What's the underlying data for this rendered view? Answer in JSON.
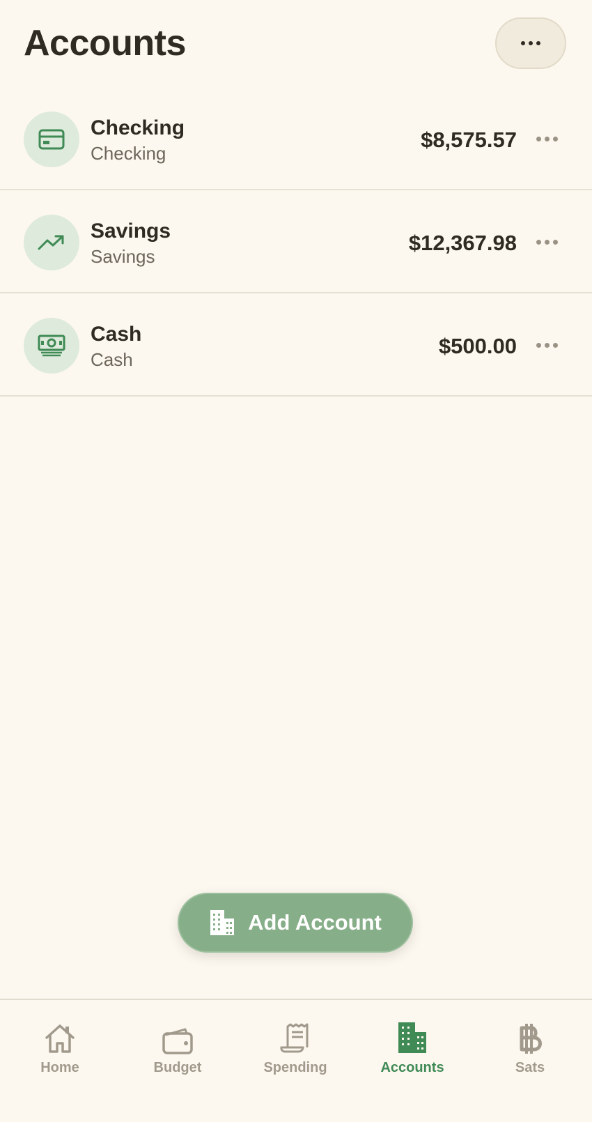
{
  "header": {
    "title": "Accounts",
    "menu_icon": "more-horizontal-icon"
  },
  "accounts": [
    {
      "name": "Checking",
      "type": "Checking",
      "balance": "$8,575.57",
      "icon": "credit-card-icon"
    },
    {
      "name": "Savings",
      "type": "Savings",
      "balance": "$12,367.98",
      "icon": "trending-up-icon"
    },
    {
      "name": "Cash",
      "type": "Cash",
      "balance": "$500.00",
      "icon": "cash-icon"
    }
  ],
  "add_button": {
    "label": "Add Account",
    "icon": "building-icon"
  },
  "tabs": [
    {
      "label": "Home",
      "icon": "home-icon",
      "active": false
    },
    {
      "label": "Budget",
      "icon": "wallet-icon",
      "active": false
    },
    {
      "label": "Spending",
      "icon": "receipt-icon",
      "active": false
    },
    {
      "label": "Accounts",
      "icon": "building-icon",
      "active": true
    },
    {
      "label": "Sats",
      "icon": "bitcoin-icon",
      "active": false
    }
  ],
  "colors": {
    "background": "#fcf8f0",
    "accent": "#3f8a55",
    "button": "#86ae88",
    "avatar_bg": "#deeadc",
    "inactive": "#a19a8c"
  }
}
